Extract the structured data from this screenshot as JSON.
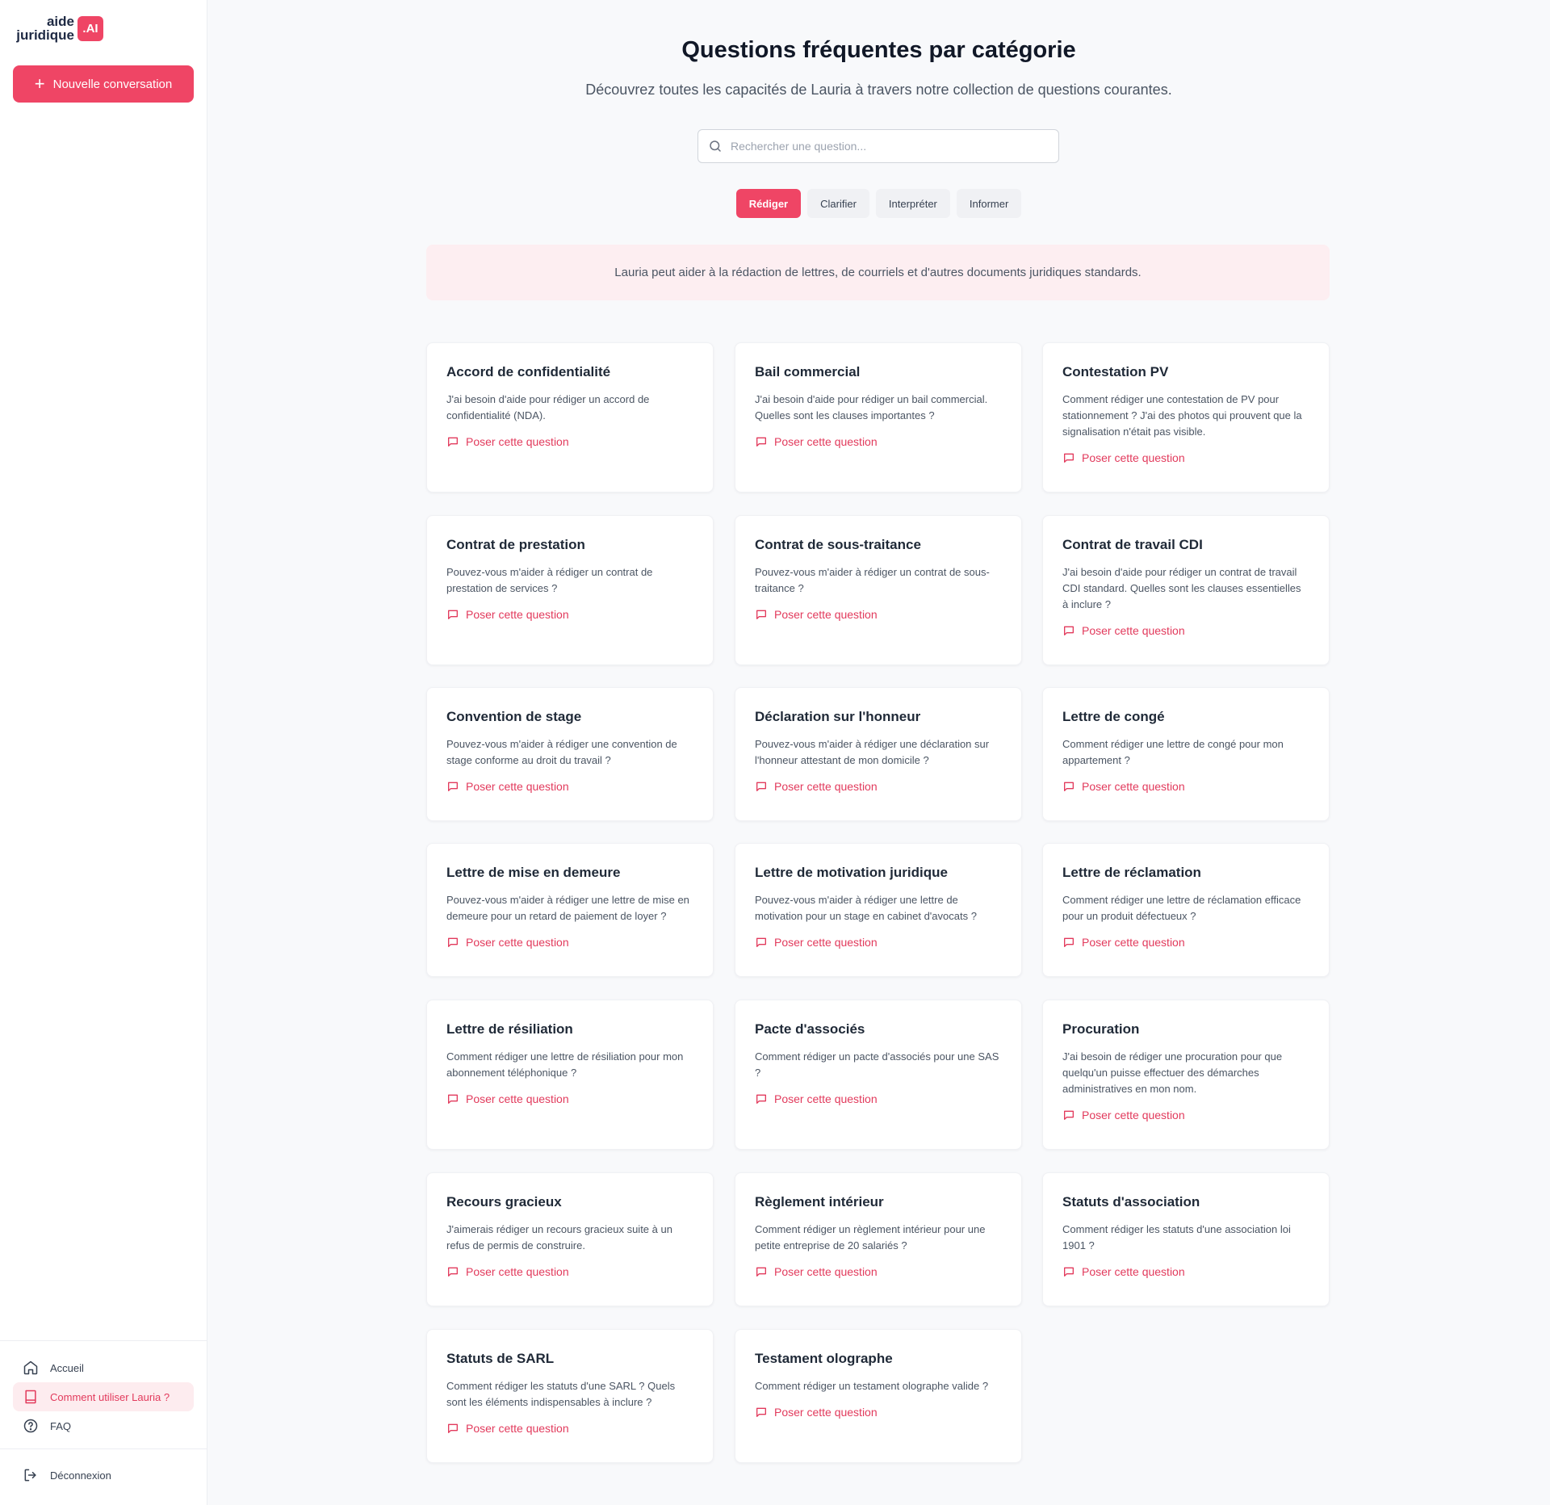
{
  "brand": {
    "line1": "aide",
    "line2": "juridique",
    "badge": ".AI"
  },
  "sidebar": {
    "new_conversation": "Nouvelle conversation",
    "nav": [
      {
        "label": "Accueil",
        "icon": "home-icon",
        "active": false
      },
      {
        "label": "Comment utiliser Lauria ?",
        "icon": "book-icon",
        "active": true
      },
      {
        "label": "FAQ",
        "icon": "help-circle-icon",
        "active": false
      }
    ],
    "logout": "Déconnexion"
  },
  "header": {
    "title": "Questions fréquentes par catégorie",
    "subtitle": "Découvrez toutes les capacités de Lauria à travers notre collection de questions courantes."
  },
  "search": {
    "placeholder": "Rechercher une question...",
    "value": ""
  },
  "tabs": [
    {
      "label": "Rédiger",
      "active": true
    },
    {
      "label": "Clarifier",
      "active": false
    },
    {
      "label": "Interpréter",
      "active": false
    },
    {
      "label": "Informer",
      "active": false
    }
  ],
  "banner": "Lauria peut aider à la rédaction de lettres, de courriels et d'autres documents juridiques standards.",
  "ask_label": "Poser cette question",
  "colors": {
    "accent": "#ef4565",
    "accent_text": "#e23a5c",
    "banner_bg": "#fdeef1"
  },
  "cards": [
    {
      "title": "Accord de confidentialité",
      "desc": "J'ai besoin d'aide pour rédiger un accord de confidentialité (NDA)."
    },
    {
      "title": "Bail commercial",
      "desc": "J'ai besoin d'aide pour rédiger un bail commercial. Quelles sont les clauses importantes ?"
    },
    {
      "title": "Contestation PV",
      "desc": "Comment rédiger une contestation de PV pour stationnement ? J'ai des photos qui prouvent que la signalisation n'était pas visible."
    },
    {
      "title": "Contrat de prestation",
      "desc": "Pouvez-vous m'aider à rédiger un contrat de prestation de services ?"
    },
    {
      "title": "Contrat de sous-traitance",
      "desc": "Pouvez-vous m'aider à rédiger un contrat de sous-traitance ?"
    },
    {
      "title": "Contrat de travail CDI",
      "desc": "J'ai besoin d'aide pour rédiger un contrat de travail CDI standard. Quelles sont les clauses essentielles à inclure ?"
    },
    {
      "title": "Convention de stage",
      "desc": "Pouvez-vous m'aider à rédiger une convention de stage conforme au droit du travail ?"
    },
    {
      "title": "Déclaration sur l'honneur",
      "desc": "Pouvez-vous m'aider à rédiger une déclaration sur l'honneur attestant de mon domicile ?"
    },
    {
      "title": "Lettre de congé",
      "desc": "Comment rédiger une lettre de congé pour mon appartement ?"
    },
    {
      "title": "Lettre de mise en demeure",
      "desc": "Pouvez-vous m'aider à rédiger une lettre de mise en demeure pour un retard de paiement de loyer ?"
    },
    {
      "title": "Lettre de motivation juridique",
      "desc": "Pouvez-vous m'aider à rédiger une lettre de motivation pour un stage en cabinet d'avocats ?"
    },
    {
      "title": "Lettre de réclamation",
      "desc": "Comment rédiger une lettre de réclamation efficace pour un produit défectueux ?"
    },
    {
      "title": "Lettre de résiliation",
      "desc": "Comment rédiger une lettre de résiliation pour mon abonnement téléphonique ?"
    },
    {
      "title": "Pacte d'associés",
      "desc": "Comment rédiger un pacte d'associés pour une SAS ?"
    },
    {
      "title": "Procuration",
      "desc": "J'ai besoin de rédiger une procuration pour que quelqu'un puisse effectuer des démarches administratives en mon nom."
    },
    {
      "title": "Recours gracieux",
      "desc": "J'aimerais rédiger un recours gracieux suite à un refus de permis de construire."
    },
    {
      "title": "Règlement intérieur",
      "desc": "Comment rédiger un règlement intérieur pour une petite entreprise de 20 salariés ?"
    },
    {
      "title": "Statuts d'association",
      "desc": "Comment rédiger les statuts d'une association loi 1901 ?"
    },
    {
      "title": "Statuts de SARL",
      "desc": "Comment rédiger les statuts d'une SARL ? Quels sont les éléments indispensables à inclure ?"
    },
    {
      "title": "Testament olographe",
      "desc": "Comment rédiger un testament olographe valide ?"
    }
  ]
}
